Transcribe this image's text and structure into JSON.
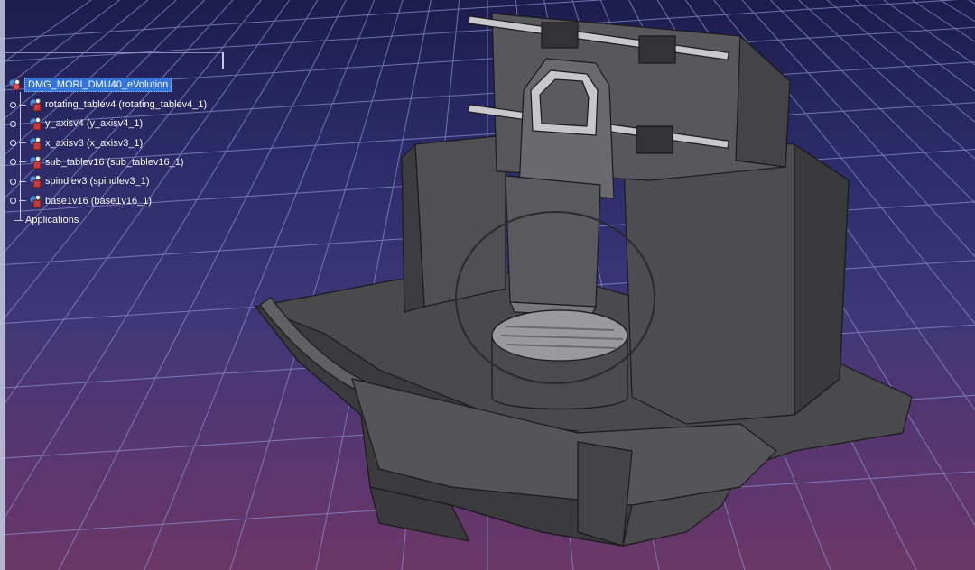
{
  "tree": {
    "root": {
      "label": "DMG_MORI_DMU40_eVolution",
      "icon": "product-icon"
    },
    "children": [
      {
        "label": "rotating_tablev4 (rotating_tablev4_1)",
        "icon": "part-icon"
      },
      {
        "label": "y_axisv4 (y_axisv4_1)",
        "icon": "part-icon"
      },
      {
        "label": "x_axisv3 (x_axisv3_1)",
        "icon": "part-icon"
      },
      {
        "label": "sub_tablev16 (sub_tablev16_1)",
        "icon": "part-icon"
      },
      {
        "label": "spindlev3 (spindlev3_1)",
        "icon": "part-icon"
      },
      {
        "label": "base1v16 (base1v16_1)",
        "icon": "part-icon"
      }
    ],
    "applications_label": "Applications"
  },
  "colors": {
    "background_top": "#1d1c4d",
    "background_bottom": "#6a3766",
    "grid": "#8d8fd0",
    "selection": "#3274d8",
    "machine_dark": "#3d3d40",
    "machine_mid": "#56565a",
    "machine_light": "#7a7a7e",
    "rail": "#c9c9cc"
  }
}
